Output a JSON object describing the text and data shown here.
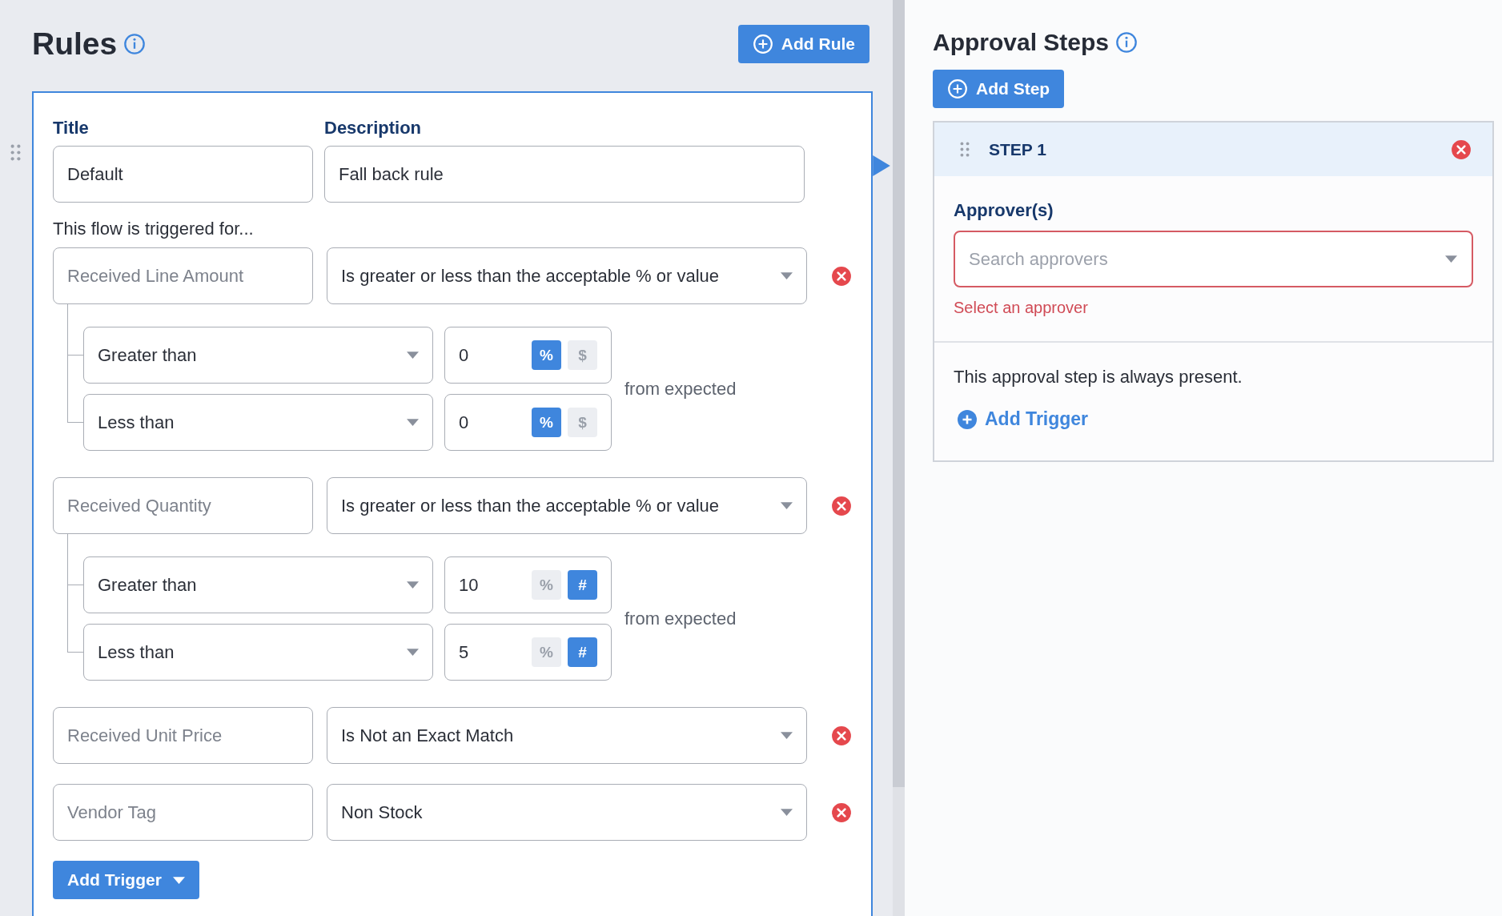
{
  "rules": {
    "title": "Rules",
    "add_button": "Add Rule",
    "card": {
      "title_label": "Title",
      "title_value": "Default",
      "description_label": "Description",
      "description_value": "Fall back rule",
      "intro": "This flow is triggered for...",
      "triggers": [
        {
          "kind": "range",
          "field": "Received Line Amount",
          "disabled": true,
          "condition": "Is greater or less than the acceptable % or value",
          "suffix": "from expected",
          "conditions": [
            {
              "operator": "Greater than",
              "value": "0",
              "units": [
                {
                  "label": "%",
                  "selected": true
                },
                {
                  "label": "$",
                  "selected": false
                }
              ]
            },
            {
              "operator": "Less than",
              "value": "0",
              "units": [
                {
                  "label": "%",
                  "selected": true
                },
                {
                  "label": "$",
                  "selected": false
                }
              ]
            }
          ]
        },
        {
          "kind": "range",
          "field": "Received Quantity",
          "disabled": true,
          "condition": "Is greater or less than the acceptable % or value",
          "suffix": "from expected",
          "conditions": [
            {
              "operator": "Greater than",
              "value": "10",
              "units": [
                {
                  "label": "%",
                  "selected": false
                },
                {
                  "label": "#",
                  "selected": true
                }
              ]
            },
            {
              "operator": "Less than",
              "value": "5",
              "units": [
                {
                  "label": "%",
                  "selected": false
                },
                {
                  "label": "#",
                  "selected": true
                }
              ]
            }
          ]
        },
        {
          "kind": "simple",
          "field": "Received Unit Price",
          "disabled": true,
          "condition": "Is Not an Exact Match"
        },
        {
          "kind": "simple",
          "field": "Vendor Tag",
          "disabled": true,
          "condition": "Non Stock"
        }
      ],
      "add_trigger": "Add Trigger"
    }
  },
  "approval": {
    "title": "Approval Steps",
    "add_button": "Add Step",
    "steps": [
      {
        "label": "STEP 1",
        "approvers_label": "Approver(s)",
        "approvers_placeholder": "Search approvers",
        "invalid": true,
        "error": "Select an approver",
        "note": "This approval step is always present.",
        "add_trigger": "Add Trigger"
      }
    ]
  }
}
